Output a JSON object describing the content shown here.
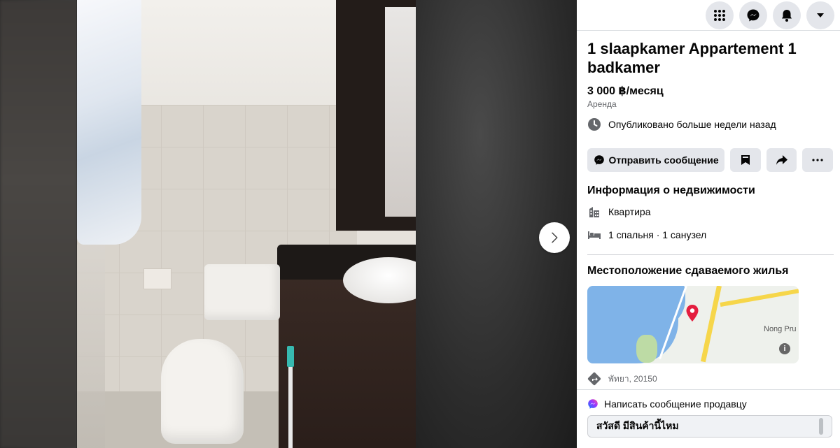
{
  "listing": {
    "title": "1 slaapkamer Appartement 1 badkamer",
    "price": "3 000 ฿/месяц",
    "type": "Аренда",
    "posted": "Опубликовано больше недели назад"
  },
  "actions": {
    "message_label": "Отправить сообщение"
  },
  "property": {
    "section_title": "Информация о недвижимости",
    "kind": "Квартира",
    "rooms": "1 спальня · 1 санузел"
  },
  "location": {
    "section_title": "Местоположение сдаваемого жилья",
    "map_label": "Nong Pru",
    "map_info": "i",
    "address": "พัทยา, 20150"
  },
  "seller": {
    "heading": "Написать сообщение продавцу",
    "message": "สวัสดี มีสินค้านี้ไหม"
  },
  "icons": {
    "top": [
      "apps-grid-icon",
      "messenger-icon",
      "notifications-icon",
      "account-menu-icon"
    ]
  },
  "colors": {
    "panel_bg": "#ffffff",
    "button_bg": "#e4e6eb",
    "map_pin": "#e41e3f"
  }
}
